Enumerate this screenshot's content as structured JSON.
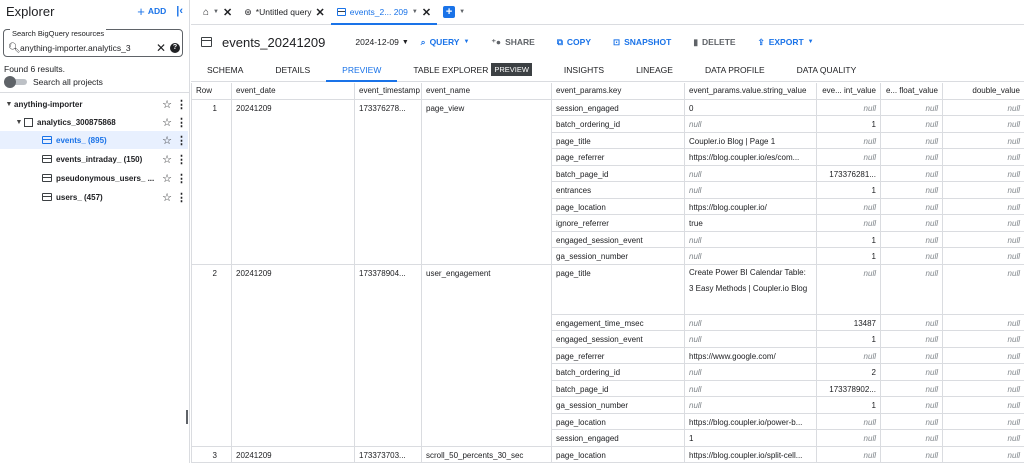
{
  "explorer": {
    "title": "Explorer",
    "add_label": "ADD",
    "search_legend": "Search BigQuery resources",
    "search_value": "anything-importer.analytics_3",
    "found_text": "Found 6 results.",
    "search_all_label": "Search all projects",
    "tree": [
      {
        "label": "anything-importer",
        "level": 0,
        "icon": "none",
        "selected": false,
        "caret": "down"
      },
      {
        "label": "analytics_300875868",
        "level": 1,
        "icon": "dataset-icon",
        "selected": false,
        "caret": "down"
      },
      {
        "label": "events_ (895)",
        "level": 2,
        "icon": "table-icon",
        "selected": true,
        "caret": "none"
      },
      {
        "label": "events_intraday_ (150)",
        "level": 2,
        "icon": "table-icon",
        "selected": false,
        "caret": "none"
      },
      {
        "label": "pseudonymous_users_ ...",
        "level": 2,
        "icon": "table-icon",
        "selected": false,
        "caret": "none"
      },
      {
        "label": "users_ (457)",
        "level": 2,
        "icon": "table-icon",
        "selected": false,
        "caret": "none"
      }
    ]
  },
  "tabs": [
    {
      "label": "",
      "kind": "home"
    },
    {
      "label": "*Untitled query",
      "kind": "query"
    },
    {
      "label": "events_2... 209",
      "kind": "table",
      "active": true
    }
  ],
  "table_view": {
    "title": "events_20241209",
    "date": "2024-12-09",
    "actions": [
      {
        "label": "QUERY",
        "icon": "search-icon",
        "disabled": false,
        "dropdown": true
      },
      {
        "label": "SHARE",
        "icon": "person-add-icon",
        "disabled": true,
        "dropdown": false
      },
      {
        "label": "COPY",
        "icon": "copy-icon",
        "disabled": false,
        "dropdown": false
      },
      {
        "label": "SNAPSHOT",
        "icon": "snapshot-icon",
        "disabled": false,
        "dropdown": false
      },
      {
        "label": "DELETE",
        "icon": "trash-icon",
        "disabled": true,
        "dropdown": false
      },
      {
        "label": "EXPORT",
        "icon": "export-icon",
        "disabled": false,
        "dropdown": true
      }
    ],
    "subtabs": [
      "SCHEMA",
      "DETAILS",
      "PREVIEW",
      "TABLE EXPLORER",
      "INSIGHTS",
      "LINEAGE",
      "DATA PROFILE",
      "DATA QUALITY"
    ],
    "active_subtab": "PREVIEW",
    "preview_badge": "PREVIEW"
  },
  "grid": {
    "columns": [
      "Row",
      "event_date",
      "event_timestamp",
      "event_name",
      "event_params.key",
      "event_params.value.string_value",
      "eve... int_value",
      "e... float_value",
      "double_value"
    ],
    "null_text": "null",
    "records": [
      {
        "row": "1",
        "event_date": "20241209",
        "event_timestamp": "173376278...",
        "event_name": "page_view",
        "params": [
          {
            "key": "session_engaged",
            "string": "0",
            "int": null
          },
          {
            "key": "batch_ordering_id",
            "string": null,
            "int": "1"
          },
          {
            "key": "page_title",
            "string": "Coupler.io Blog | Page 1",
            "int": null
          },
          {
            "key": "page_referrer",
            "string": "https://blog.coupler.io/es/com...",
            "int": null
          },
          {
            "key": "batch_page_id",
            "string": null,
            "int": "173376281..."
          },
          {
            "key": "entrances",
            "string": null,
            "int": "1"
          },
          {
            "key": "page_location",
            "string": "https://blog.coupler.io/",
            "int": null
          },
          {
            "key": "ignore_referrer",
            "string": "true",
            "int": null
          },
          {
            "key": "engaged_session_event",
            "string": null,
            "int": "1"
          },
          {
            "key": "ga_session_number",
            "string": null,
            "int": "1"
          }
        ]
      },
      {
        "row": "2",
        "event_date": "20241209",
        "event_timestamp": "173378904...",
        "event_name": "user_engagement",
        "params": [
          {
            "key": "page_title",
            "string": "Create Power BI Calendar Table: 3 Easy Methods | Coupler.io Blog",
            "int": null,
            "tall": true
          },
          {
            "key": "engagement_time_msec",
            "string": null,
            "int": "13487"
          },
          {
            "key": "engaged_session_event",
            "string": null,
            "int": "1"
          },
          {
            "key": "page_referrer",
            "string": "https://www.google.com/",
            "int": null
          },
          {
            "key": "batch_ordering_id",
            "string": null,
            "int": "2"
          },
          {
            "key": "batch_page_id",
            "string": null,
            "int": "173378902..."
          },
          {
            "key": "ga_session_number",
            "string": null,
            "int": "1"
          },
          {
            "key": "page_location",
            "string": "https://blog.coupler.io/power-b...",
            "int": null
          },
          {
            "key": "session_engaged",
            "string": "1",
            "int": null
          }
        ]
      },
      {
        "row": "3",
        "event_date": "20241209",
        "event_timestamp": "173373703...",
        "event_name": "scroll_50_percents_30_sec",
        "params": [
          {
            "key": "page_location",
            "string": "https://blog.coupler.io/split-cell...",
            "int": null
          }
        ]
      }
    ]
  },
  "colors": {
    "accent": "#1a73e8",
    "border": "#dadce0",
    "selected_bg": "#e8f0fe",
    "null_text": "#80868b"
  }
}
